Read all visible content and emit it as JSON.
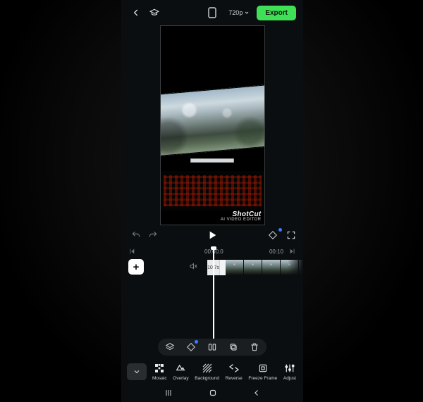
{
  "header": {
    "resolution_label": "720p",
    "export_label": "Export"
  },
  "watermark": {
    "brand": "ShotCut",
    "tagline": "AI VIDEO EDITOR"
  },
  "timeline": {
    "current": "00:00.0",
    "duration": "00:10",
    "clip_badge": "10.7s",
    "thumb_count": 5
  },
  "toolbar": {
    "items": [
      {
        "id": "mosaic",
        "label": "Mosaic"
      },
      {
        "id": "overlay",
        "label": "Overlay"
      },
      {
        "id": "background",
        "label": "Background"
      },
      {
        "id": "reverse",
        "label": "Reverse"
      },
      {
        "id": "freeze",
        "label": "Freeze Frame"
      },
      {
        "id": "adjust",
        "label": "Adjust"
      }
    ]
  },
  "colors": {
    "accent": "#3fe056"
  }
}
